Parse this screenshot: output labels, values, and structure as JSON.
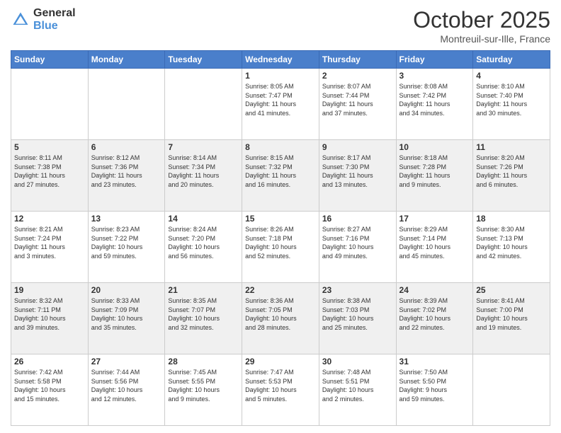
{
  "logo": {
    "general": "General",
    "blue": "Blue"
  },
  "header": {
    "month": "October 2025",
    "location": "Montreuil-sur-Ille, France"
  },
  "days_of_week": [
    "Sunday",
    "Monday",
    "Tuesday",
    "Wednesday",
    "Thursday",
    "Friday",
    "Saturday"
  ],
  "weeks": [
    [
      {
        "day": "",
        "info": ""
      },
      {
        "day": "",
        "info": ""
      },
      {
        "day": "",
        "info": ""
      },
      {
        "day": "1",
        "info": "Sunrise: 8:05 AM\nSunset: 7:47 PM\nDaylight: 11 hours\nand 41 minutes."
      },
      {
        "day": "2",
        "info": "Sunrise: 8:07 AM\nSunset: 7:44 PM\nDaylight: 11 hours\nand 37 minutes."
      },
      {
        "day": "3",
        "info": "Sunrise: 8:08 AM\nSunset: 7:42 PM\nDaylight: 11 hours\nand 34 minutes."
      },
      {
        "day": "4",
        "info": "Sunrise: 8:10 AM\nSunset: 7:40 PM\nDaylight: 11 hours\nand 30 minutes."
      }
    ],
    [
      {
        "day": "5",
        "info": "Sunrise: 8:11 AM\nSunset: 7:38 PM\nDaylight: 11 hours\nand 27 minutes."
      },
      {
        "day": "6",
        "info": "Sunrise: 8:12 AM\nSunset: 7:36 PM\nDaylight: 11 hours\nand 23 minutes."
      },
      {
        "day": "7",
        "info": "Sunrise: 8:14 AM\nSunset: 7:34 PM\nDaylight: 11 hours\nand 20 minutes."
      },
      {
        "day": "8",
        "info": "Sunrise: 8:15 AM\nSunset: 7:32 PM\nDaylight: 11 hours\nand 16 minutes."
      },
      {
        "day": "9",
        "info": "Sunrise: 8:17 AM\nSunset: 7:30 PM\nDaylight: 11 hours\nand 13 minutes."
      },
      {
        "day": "10",
        "info": "Sunrise: 8:18 AM\nSunset: 7:28 PM\nDaylight: 11 hours\nand 9 minutes."
      },
      {
        "day": "11",
        "info": "Sunrise: 8:20 AM\nSunset: 7:26 PM\nDaylight: 11 hours\nand 6 minutes."
      }
    ],
    [
      {
        "day": "12",
        "info": "Sunrise: 8:21 AM\nSunset: 7:24 PM\nDaylight: 11 hours\nand 3 minutes."
      },
      {
        "day": "13",
        "info": "Sunrise: 8:23 AM\nSunset: 7:22 PM\nDaylight: 10 hours\nand 59 minutes."
      },
      {
        "day": "14",
        "info": "Sunrise: 8:24 AM\nSunset: 7:20 PM\nDaylight: 10 hours\nand 56 minutes."
      },
      {
        "day": "15",
        "info": "Sunrise: 8:26 AM\nSunset: 7:18 PM\nDaylight: 10 hours\nand 52 minutes."
      },
      {
        "day": "16",
        "info": "Sunrise: 8:27 AM\nSunset: 7:16 PM\nDaylight: 10 hours\nand 49 minutes."
      },
      {
        "day": "17",
        "info": "Sunrise: 8:29 AM\nSunset: 7:14 PM\nDaylight: 10 hours\nand 45 minutes."
      },
      {
        "day": "18",
        "info": "Sunrise: 8:30 AM\nSunset: 7:13 PM\nDaylight: 10 hours\nand 42 minutes."
      }
    ],
    [
      {
        "day": "19",
        "info": "Sunrise: 8:32 AM\nSunset: 7:11 PM\nDaylight: 10 hours\nand 39 minutes."
      },
      {
        "day": "20",
        "info": "Sunrise: 8:33 AM\nSunset: 7:09 PM\nDaylight: 10 hours\nand 35 minutes."
      },
      {
        "day": "21",
        "info": "Sunrise: 8:35 AM\nSunset: 7:07 PM\nDaylight: 10 hours\nand 32 minutes."
      },
      {
        "day": "22",
        "info": "Sunrise: 8:36 AM\nSunset: 7:05 PM\nDaylight: 10 hours\nand 28 minutes."
      },
      {
        "day": "23",
        "info": "Sunrise: 8:38 AM\nSunset: 7:03 PM\nDaylight: 10 hours\nand 25 minutes."
      },
      {
        "day": "24",
        "info": "Sunrise: 8:39 AM\nSunset: 7:02 PM\nDaylight: 10 hours\nand 22 minutes."
      },
      {
        "day": "25",
        "info": "Sunrise: 8:41 AM\nSunset: 7:00 PM\nDaylight: 10 hours\nand 19 minutes."
      }
    ],
    [
      {
        "day": "26",
        "info": "Sunrise: 7:42 AM\nSunset: 5:58 PM\nDaylight: 10 hours\nand 15 minutes."
      },
      {
        "day": "27",
        "info": "Sunrise: 7:44 AM\nSunset: 5:56 PM\nDaylight: 10 hours\nand 12 minutes."
      },
      {
        "day": "28",
        "info": "Sunrise: 7:45 AM\nSunset: 5:55 PM\nDaylight: 10 hours\nand 9 minutes."
      },
      {
        "day": "29",
        "info": "Sunrise: 7:47 AM\nSunset: 5:53 PM\nDaylight: 10 hours\nand 5 minutes."
      },
      {
        "day": "30",
        "info": "Sunrise: 7:48 AM\nSunset: 5:51 PM\nDaylight: 10 hours\nand 2 minutes."
      },
      {
        "day": "31",
        "info": "Sunrise: 7:50 AM\nSunset: 5:50 PM\nDaylight: 9 hours\nand 59 minutes."
      },
      {
        "day": "",
        "info": ""
      }
    ]
  ]
}
